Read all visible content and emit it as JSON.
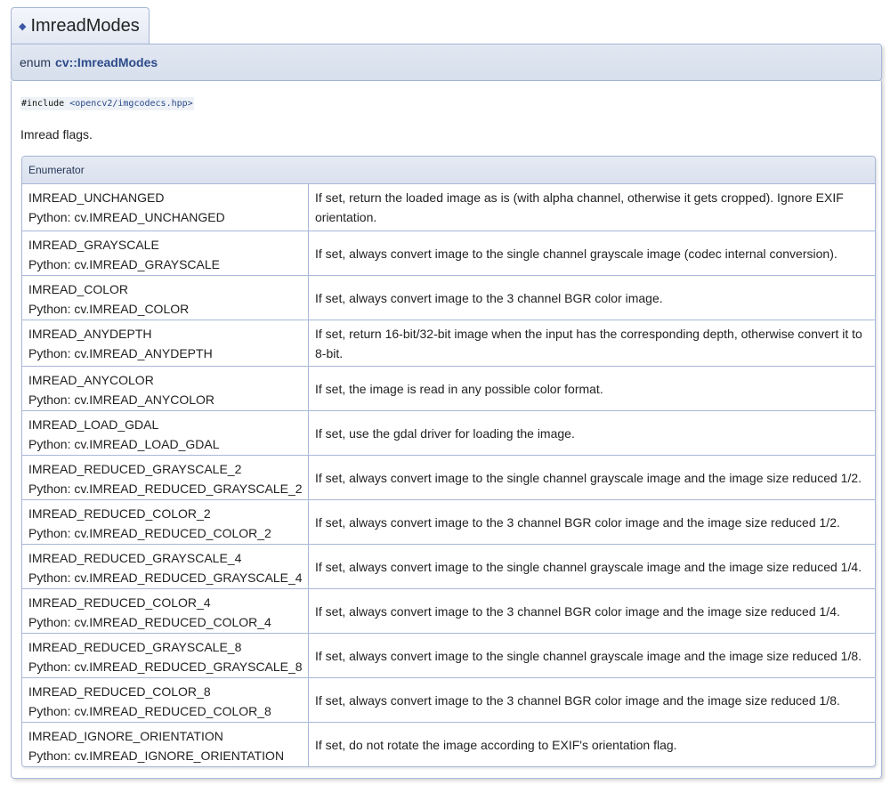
{
  "tab": {
    "title": "ImreadModes"
  },
  "proto": {
    "keyword": "enum",
    "name": "cv::ImreadModes"
  },
  "include": {
    "prefix": "#include",
    "path": "<opencv2/imgcodecs.hpp>"
  },
  "brief": "Imread flags.",
  "table": {
    "header": "Enumerator",
    "rows": [
      {
        "name": "IMREAD_UNCHANGED",
        "python": "Python: cv.IMREAD_UNCHANGED",
        "desc": "If set, return the loaded image as is (with alpha channel, otherwise it gets cropped). Ignore EXIF orientation."
      },
      {
        "name": "IMREAD_GRAYSCALE",
        "python": "Python: cv.IMREAD_GRAYSCALE",
        "desc": "If set, always convert image to the single channel grayscale image (codec internal conversion)."
      },
      {
        "name": "IMREAD_COLOR",
        "python": "Python: cv.IMREAD_COLOR",
        "desc": "If set, always convert image to the 3 channel BGR color image."
      },
      {
        "name": "IMREAD_ANYDEPTH",
        "python": "Python: cv.IMREAD_ANYDEPTH",
        "desc": "If set, return 16-bit/32-bit image when the input has the corresponding depth, otherwise convert it to 8-bit."
      },
      {
        "name": "IMREAD_ANYCOLOR",
        "python": "Python: cv.IMREAD_ANYCOLOR",
        "desc": "If set, the image is read in any possible color format."
      },
      {
        "name": "IMREAD_LOAD_GDAL",
        "python": "Python: cv.IMREAD_LOAD_GDAL",
        "desc": "If set, use the gdal driver for loading the image."
      },
      {
        "name": "IMREAD_REDUCED_GRAYSCALE_2",
        "python": "Python: cv.IMREAD_REDUCED_GRAYSCALE_2",
        "desc": "If set, always convert image to the single channel grayscale image and the image size reduced 1/2."
      },
      {
        "name": "IMREAD_REDUCED_COLOR_2",
        "python": "Python: cv.IMREAD_REDUCED_COLOR_2",
        "desc": "If set, always convert image to the 3 channel BGR color image and the image size reduced 1/2."
      },
      {
        "name": "IMREAD_REDUCED_GRAYSCALE_4",
        "python": "Python: cv.IMREAD_REDUCED_GRAYSCALE_4",
        "desc": "If set, always convert image to the single channel grayscale image and the image size reduced 1/4."
      },
      {
        "name": "IMREAD_REDUCED_COLOR_4",
        "python": "Python: cv.IMREAD_REDUCED_COLOR_4",
        "desc": "If set, always convert image to the 3 channel BGR color image and the image size reduced 1/4."
      },
      {
        "name": "IMREAD_REDUCED_GRAYSCALE_8",
        "python": "Python: cv.IMREAD_REDUCED_GRAYSCALE_8",
        "desc": "If set, always convert image to the single channel grayscale image and the image size reduced 1/8."
      },
      {
        "name": "IMREAD_REDUCED_COLOR_8",
        "python": "Python: cv.IMREAD_REDUCED_COLOR_8",
        "desc": "If set, always convert image to the 3 channel BGR color image and the image size reduced 1/8."
      },
      {
        "name": "IMREAD_IGNORE_ORIENTATION",
        "python": "Python: cv.IMREAD_IGNORE_ORIENTATION",
        "desc": "If set, do not rotate the image according to EXIF's orientation flag."
      }
    ]
  }
}
